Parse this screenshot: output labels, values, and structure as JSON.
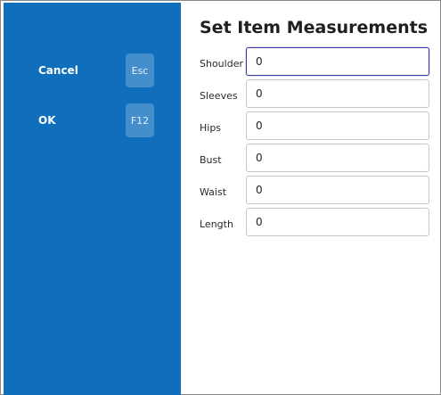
{
  "sidebar": {
    "actions": [
      {
        "label": "Cancel",
        "key": "Esc"
      },
      {
        "label": "OK",
        "key": "F12"
      }
    ]
  },
  "form": {
    "title": "Set Item Measurements",
    "fields": [
      {
        "label": "Shoulder",
        "value": "0"
      },
      {
        "label": "Sleeves",
        "value": "0"
      },
      {
        "label": "Hips",
        "value": "0"
      },
      {
        "label": "Bust",
        "value": "0"
      },
      {
        "label": "Waist",
        "value": "0"
      },
      {
        "label": "Length",
        "value": "0"
      }
    ]
  },
  "colors": {
    "sidebar": "#0f6fbd",
    "focus_border": "#3a3aa8"
  }
}
